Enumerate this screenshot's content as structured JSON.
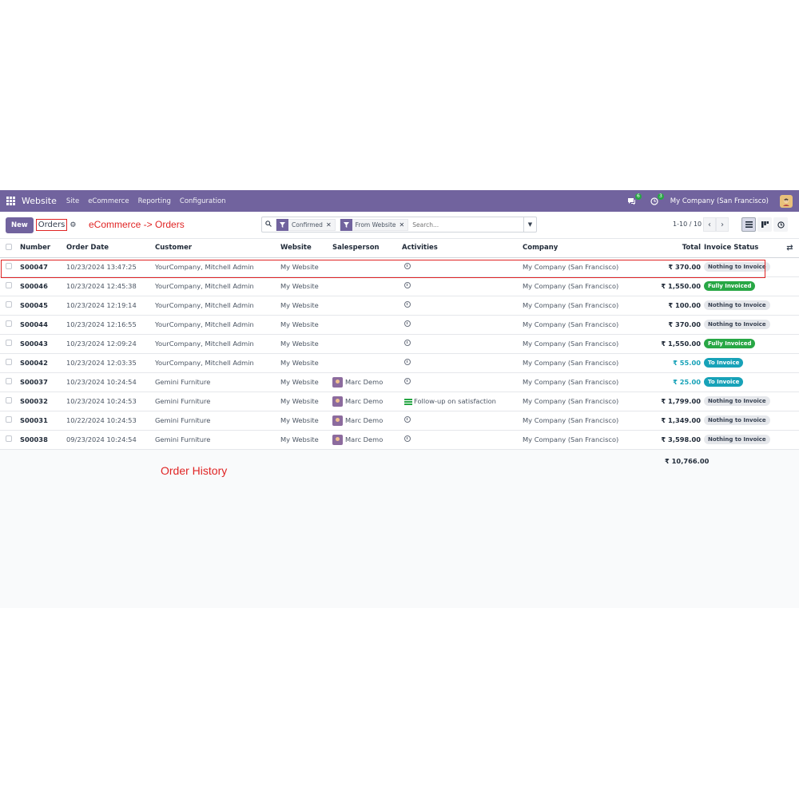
{
  "navbar": {
    "brand": "Website",
    "menu": [
      "Site",
      "eCommerce",
      "Reporting",
      "Configuration"
    ],
    "messages_count": "6",
    "activities_count": "3",
    "company": "My Company (San Francisco)"
  },
  "control": {
    "new_label": "New",
    "breadcrumb": "Orders",
    "annotation": "eCommerce -> Orders",
    "facets": [
      "Confirmed",
      "From Website"
    ],
    "search_placeholder": "Search...",
    "pager": "1-10 / 10"
  },
  "table": {
    "columns": [
      "Number",
      "Order Date",
      "Customer",
      "Website",
      "Salesperson",
      "Activities",
      "Company",
      "Total",
      "Invoice Status"
    ],
    "rows": [
      {
        "number": "S00047",
        "date": "10/23/2024 13:47:25",
        "customer": "YourCompany, Mitchell Admin",
        "website": "My Website",
        "salesperson": "",
        "activity": "",
        "company": "My Company (San Francisco)",
        "total": "₹ 370.00",
        "status": "Nothing to Invoice",
        "status_type": "nothing"
      },
      {
        "number": "S00046",
        "date": "10/23/2024 12:45:38",
        "customer": "YourCompany, Mitchell Admin",
        "website": "My Website",
        "salesperson": "",
        "activity": "",
        "company": "My Company (San Francisco)",
        "total": "₹ 1,550.00",
        "status": "Fully Invoiced",
        "status_type": "fully"
      },
      {
        "number": "S00045",
        "date": "10/23/2024 12:19:14",
        "customer": "YourCompany, Mitchell Admin",
        "website": "My Website",
        "salesperson": "",
        "activity": "",
        "company": "My Company (San Francisco)",
        "total": "₹ 100.00",
        "status": "Nothing to Invoice",
        "status_type": "nothing"
      },
      {
        "number": "S00044",
        "date": "10/23/2024 12:16:55",
        "customer": "YourCompany, Mitchell Admin",
        "website": "My Website",
        "salesperson": "",
        "activity": "",
        "company": "My Company (San Francisco)",
        "total": "₹ 370.00",
        "status": "Nothing to Invoice",
        "status_type": "nothing"
      },
      {
        "number": "S00043",
        "date": "10/23/2024 12:09:24",
        "customer": "YourCompany, Mitchell Admin",
        "website": "My Website",
        "salesperson": "",
        "activity": "",
        "company": "My Company (San Francisco)",
        "total": "₹ 1,550.00",
        "status": "Fully Invoiced",
        "status_type": "fully"
      },
      {
        "number": "S00042",
        "date": "10/23/2024 12:03:35",
        "customer": "YourCompany, Mitchell Admin",
        "website": "My Website",
        "salesperson": "",
        "activity": "",
        "company": "My Company (San Francisco)",
        "total": "₹ 55.00",
        "status": "To Invoice",
        "status_type": "toinv"
      },
      {
        "number": "S00037",
        "date": "10/23/2024 10:24:54",
        "customer": "Gemini Furniture",
        "website": "My Website",
        "salesperson": "Marc Demo",
        "activity": "",
        "company": "My Company (San Francisco)",
        "total": "₹ 25.00",
        "status": "To Invoice",
        "status_type": "toinv"
      },
      {
        "number": "S00032",
        "date": "10/23/2024 10:24:53",
        "customer": "Gemini Furniture",
        "website": "My Website",
        "salesperson": "Marc Demo",
        "activity": "Follow-up on satisfaction",
        "company": "My Company (San Francisco)",
        "total": "₹ 1,799.00",
        "status": "Nothing to Invoice",
        "status_type": "nothing"
      },
      {
        "number": "S00031",
        "date": "10/22/2024 10:24:53",
        "customer": "Gemini Furniture",
        "website": "My Website",
        "salesperson": "Marc Demo",
        "activity": "",
        "company": "My Company (San Francisco)",
        "total": "₹ 1,349.00",
        "status": "Nothing to Invoice",
        "status_type": "nothing"
      },
      {
        "number": "S00038",
        "date": "09/23/2024 10:24:54",
        "customer": "Gemini Furniture",
        "website": "My Website",
        "salesperson": "Marc Demo",
        "activity": "",
        "company": "My Company (San Francisco)",
        "total": "₹ 3,598.00",
        "status": "Nothing to Invoice",
        "status_type": "nothing"
      }
    ],
    "grand_total": "₹ 10,766.00"
  },
  "annotation_history": "Order History",
  "colors": {
    "brand": "#71639e",
    "annotation": "#e02424",
    "fully_invoiced": "#28a745",
    "to_invoice": "#17a2b8"
  }
}
